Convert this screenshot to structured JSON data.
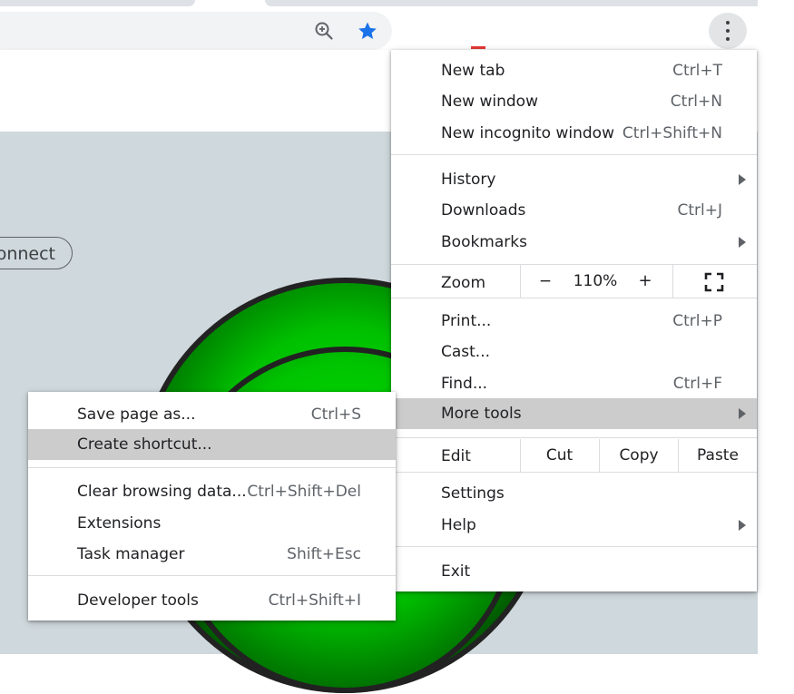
{
  "browser": {
    "icons": {
      "zoom": "zoom-in-icon",
      "bookmark": "star-icon",
      "menu": "kebab-menu-icon",
      "fullscreen": "fullscreen-icon"
    },
    "accent_color": "#1a73e8"
  },
  "page": {
    "connect_label": "onnect",
    "ball_color": "#00c000"
  },
  "main_menu": {
    "new_tab": {
      "label": "New tab",
      "shortcut": "Ctrl+T"
    },
    "new_window": {
      "label": "New window",
      "shortcut": "Ctrl+N"
    },
    "new_incognito": {
      "label": "New incognito window",
      "shortcut": "Ctrl+Shift+N"
    },
    "history": {
      "label": "History"
    },
    "downloads": {
      "label": "Downloads",
      "shortcut": "Ctrl+J"
    },
    "bookmarks": {
      "label": "Bookmarks"
    },
    "zoom": {
      "label": "Zoom",
      "minus": "−",
      "value": "110%",
      "plus": "+"
    },
    "print": {
      "label": "Print...",
      "shortcut": "Ctrl+P"
    },
    "cast": {
      "label": "Cast..."
    },
    "find": {
      "label": "Find...",
      "shortcut": "Ctrl+F"
    },
    "more_tools": {
      "label": "More tools"
    },
    "edit": {
      "label": "Edit",
      "cut": "Cut",
      "copy": "Copy",
      "paste": "Paste"
    },
    "settings": {
      "label": "Settings"
    },
    "help": {
      "label": "Help"
    },
    "exit": {
      "label": "Exit"
    }
  },
  "sub_menu": {
    "save_page": {
      "label": "Save page as...",
      "shortcut": "Ctrl+S"
    },
    "create_shortcut": {
      "label": "Create shortcut..."
    },
    "clear_browsing": {
      "label": "Clear browsing data...",
      "shortcut": "Ctrl+Shift+Del"
    },
    "extensions": {
      "label": "Extensions"
    },
    "task_manager": {
      "label": "Task manager",
      "shortcut": "Shift+Esc"
    },
    "developer_tools": {
      "label": "Developer tools",
      "shortcut": "Ctrl+Shift+I"
    }
  }
}
